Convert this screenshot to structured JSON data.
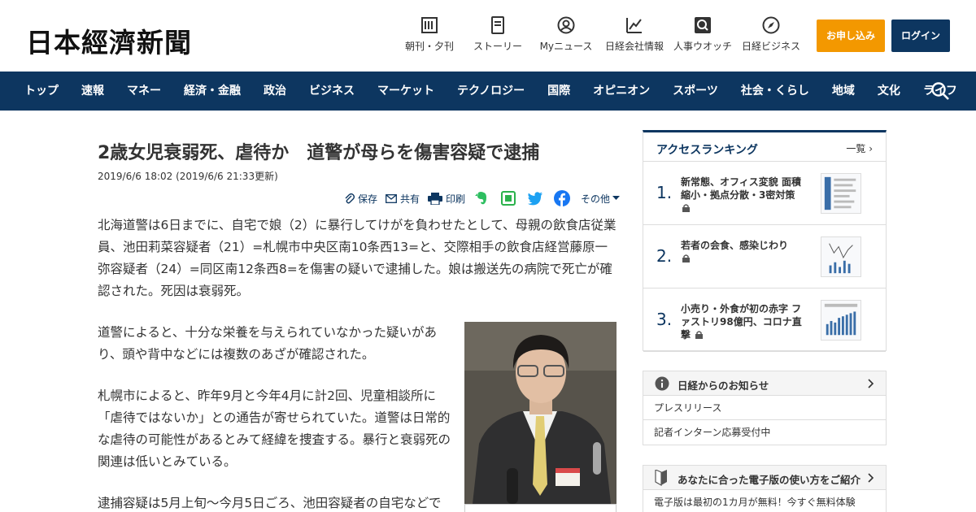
{
  "header": {
    "logo": "日本經濟新聞",
    "tools": [
      {
        "label": "朝刊・夕刊",
        "icon": "newspaper-icon"
      },
      {
        "label": "ストーリー",
        "icon": "story-icon"
      },
      {
        "label": "Myニュース",
        "icon": "user-icon"
      },
      {
        "label": "日経会社情報",
        "icon": "chart-icon"
      },
      {
        "label": "人事ウオッチ",
        "icon": "search-person-icon"
      },
      {
        "label": "日経ビジネス",
        "icon": "compass-icon"
      }
    ],
    "apply_label": "お申し込み",
    "login_label": "ログイン",
    "apply_color": "#f39800",
    "brand_color": "#0d3660"
  },
  "nav": {
    "items": [
      "トップ",
      "速報",
      "マネー",
      "経済・金融",
      "政治",
      "ビジネス",
      "マーケット",
      "テクノロジー",
      "国際",
      "オピニオン",
      "スポーツ",
      "社会・くらし",
      "地域",
      "文化",
      "ライフ"
    ]
  },
  "article": {
    "title": "2歳女児衰弱死、虐待か　道警が母らを傷害容疑で逮捕",
    "date": "2019/6/6 18:02 (2019/6/6 21:33更新)",
    "share": {
      "save": "保存",
      "share": "共有",
      "print": "印刷",
      "other": "その他"
    },
    "paragraphs": [
      "北海道警は6日までに、自宅で娘（2）に暴行してけがを負わせたとして、母親の飲食店従業員、池田莉菜容疑者（21）=札幌市中央区南10条西13=と、交際相手の飲食店経営藤原一弥容疑者（24）=同区南12条西8=を傷害の疑いで逮捕した。娘は搬送先の病院で死亡が確認された。死因は衰弱死。",
      "道警によると、十分な栄養を与えられていなかった疑いがあり、頭や背中などには複数のあざが確認された。",
      "札幌市によると、昨年9月と今年4月に計2回、児童相談所に「虐待ではないか」との通告が寄せられていた。道警は日常的な虐待の可能性があるとみて経緯を捜査する。暴行と衰弱死の関連は低いとみている。",
      "逮捕容疑は5月上旬～今月5日ごろ、池田容疑者の自宅などで"
    ]
  },
  "sidebar": {
    "ranking_title": "アクセスランキング",
    "ranking_more": "一覧",
    "ranking": [
      {
        "rank": "1.",
        "text": "新常態、オフィス変貌 面積縮小・拠点分散・3密対策"
      },
      {
        "rank": "2.",
        "text": "若者の会食、感染じわり"
      },
      {
        "rank": "3.",
        "text": "小売り・外食が初の赤字 ファストリ98億円、コロナ直撃"
      }
    ],
    "notice_title": "日経からのお知らせ",
    "notice_items": [
      "プレスリリース",
      "記者インターン応募受付中"
    ],
    "guide_title": "あなたに合った電子版の使い方をご紹介",
    "guide_item": "電子版は最初の1カ月が無料！今すぐ無料体験"
  }
}
